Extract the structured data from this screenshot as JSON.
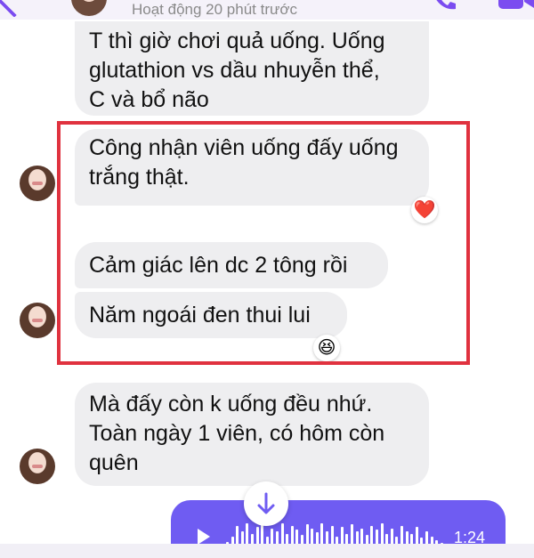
{
  "header": {
    "status": "Hoạt động 20 phút trước"
  },
  "messages": [
    {
      "text": "T thì giờ chơi quả uống. Uống\nglutathion vs dầu nhuyễn thể,\nC và bổ não"
    },
    {
      "text": "Công nhận viên uống đấy uống\ntrắng thật.",
      "reaction": "❤️"
    },
    {
      "text": "Cảm giác lên dc 2 tông rồi"
    },
    {
      "text": "Năm ngoái đen thui lui",
      "reaction": "😆"
    },
    {
      "text": "Mà đấy còn k uống đều nhứ.\nToàn ngày 1 viên, có hôm còn\nquên"
    }
  ],
  "voice_message": {
    "duration": "1:24",
    "waveform": [
      0.3,
      0.5,
      0.9,
      0.7,
      1.0,
      0.6,
      0.85,
      0.95,
      0.5,
      0.8,
      0.7,
      1.0,
      0.6,
      0.9,
      0.75,
      0.55,
      0.95,
      0.8,
      0.65,
      1.0,
      0.7,
      0.9,
      0.5,
      0.85,
      0.6,
      0.95,
      0.7,
      0.8,
      0.55,
      0.9,
      0.75,
      1.0,
      0.6,
      0.8,
      0.5,
      0.9,
      0.7,
      0.6,
      0.85,
      0.45,
      0.7,
      0.5,
      0.35,
      0.25
    ]
  },
  "colors": {
    "accent": "#6f5cf2",
    "highlight_border": "#e0323f",
    "incoming_bubble": "#eeeef0"
  }
}
